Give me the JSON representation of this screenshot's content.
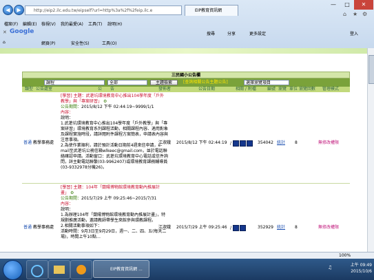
{
  "browser": {
    "address": "http://eip2.ilc.edu.tw/eipself?url=http%3a%2f%2feip.ilc.e",
    "tab_title": "EIP教育資訊網",
    "menu": [
      "檔案(F)",
      "編輯(E)",
      "檢視(V)",
      "我的最愛(A)",
      "工具(T)",
      "說明(H)"
    ],
    "google_label": "Google",
    "search_label": "搜尋",
    "share_label": "分享",
    "more_settings": "更多設定",
    "login_label": "登入",
    "toolbar": [
      "網頁(P)",
      "安全性(S)",
      "工具(O)"
    ]
  },
  "page": {
    "title": "三民國小公告欄",
    "search_value": "課程",
    "filter_value": "全部",
    "search_button": "主題檢索",
    "category_link": "[查詢相關公告主題公告]",
    "select_value": "選擇瀏覽項目",
    "columns": [
      "類型",
      "公告處室",
      "公　　告",
      "發佈者",
      "公告日期",
      "相關 / 附檔",
      "編號",
      "瀏覽",
      "單位",
      "瀏覽回數",
      "管理模式"
    ]
  },
  "rows": [
    {
      "type": "普通",
      "dept": "教學事務處",
      "subject_tag": "[學習] 主題：",
      "subject": "武荖坑環境教育中心推出104學年度「戶外教學」與「專案研習」",
      "period_label": "公告期間：",
      "period": "2015/8/12 下午 02:44:19~9999/1/1",
      "content_label": "內容：",
      "content": "說明：\n1.武荖坑環境教育中心推出104學年度「戶外教學」與「專案研習」環境教育系列課程活動，相關課程內容、適用對象及課程實施時段，請詳閱附件課程方案簡表，申請表內容與注意事項。\n2.為使作業順利，請於預計活動日期前4週來信申請，e-mail至武荖坑公務信箱wlkeec@gmail.com，並於電話聯絡確認申請。活動窗口：武荖坑環境教育中心電話或信件詢問，詳主動電話聯繫(03-9962407)或環境教育課務輔導員(03-9332978分機26)。",
      "publisher": "江淑娥",
      "date": "2015/8/12 下午 02:44:19",
      "id": "354042",
      "stat": "統計",
      "count": "8",
      "manage": "無修改權限"
    },
    {
      "type": "普通",
      "dept": "教學事務處",
      "subject_tag": "[學習] 主題：",
      "subject": "104年「蘭陽博物館環境教育動內推展計畫」",
      "period_label": "公告期間：",
      "period": "2015/7/29 上午 09:25:46~2015/7/31",
      "content_label": "內容：",
      "content": "說明：\n1.為辦理104年「蘭陽博物館環境教育動內推展計畫」，特規劃推廣活動，邀請教師帶學生來館參與環教課程。\n2.相關活動事項如下：\n活動時間：9月3日至9月29日，週一、二、四、五(每天二場)，時間上午10點…",
      "publisher": "江淑娥",
      "date": "2015/7/29 上午 09:25:46",
      "id": "352929",
      "stat": "統計",
      "count": "8",
      "manage": "無修改權限"
    }
  ],
  "status": {
    "zoom": "100%"
  },
  "taskbar": {
    "active_label": "EIP教育資訊網 ...",
    "time": "上午 09:49",
    "date": "2015/10/6"
  }
}
